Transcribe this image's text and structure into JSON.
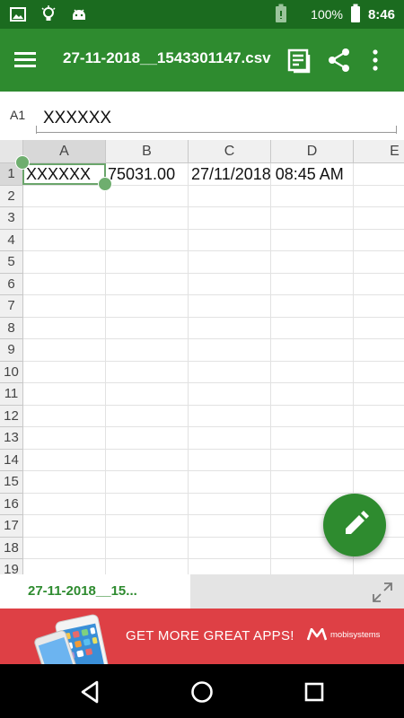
{
  "status_bar": {
    "battery_percent": "100%",
    "time": "8:46",
    "left_icons": [
      "image-icon",
      "lightbulb-icon",
      "android-icon"
    ],
    "right_icons": [
      "battery-saver-icon",
      "signal-icon",
      "battery-icon"
    ]
  },
  "app_bar": {
    "title": "27-11-2018__1543301147.csv",
    "icons": [
      "menu-icon",
      "notes-icon",
      "share-icon",
      "more-vert-icon"
    ],
    "color": "#2e8b2f",
    "status_color": "#1b6b1f"
  },
  "formula_bar": {
    "cell_ref": "A1",
    "value": "XXXXXX"
  },
  "grid": {
    "columns": [
      "A",
      "B",
      "C",
      "D",
      "E"
    ],
    "rows": [
      "1",
      "2",
      "3",
      "4",
      "5",
      "6",
      "7",
      "8",
      "9",
      "10",
      "11",
      "12",
      "13",
      "14",
      "15",
      "16",
      "17",
      "18",
      "19"
    ],
    "selected_cell": "A1",
    "cells": {
      "A1": "XXXXXX",
      "B1": "75031.00",
      "C1": "27/11/2018 08:45 AM"
    }
  },
  "fab": {
    "icon": "pencil-icon"
  },
  "sheet_tabs": {
    "active": "27-11-2018__15...",
    "expand_icon": "expand-icon"
  },
  "ad_banner": {
    "text": "GET MORE GREAT APPS!",
    "brand": "mobisystems",
    "color": "#de4045"
  },
  "nav_bar": {
    "icons": [
      "back-icon",
      "home-icon",
      "recents-icon"
    ]
  }
}
